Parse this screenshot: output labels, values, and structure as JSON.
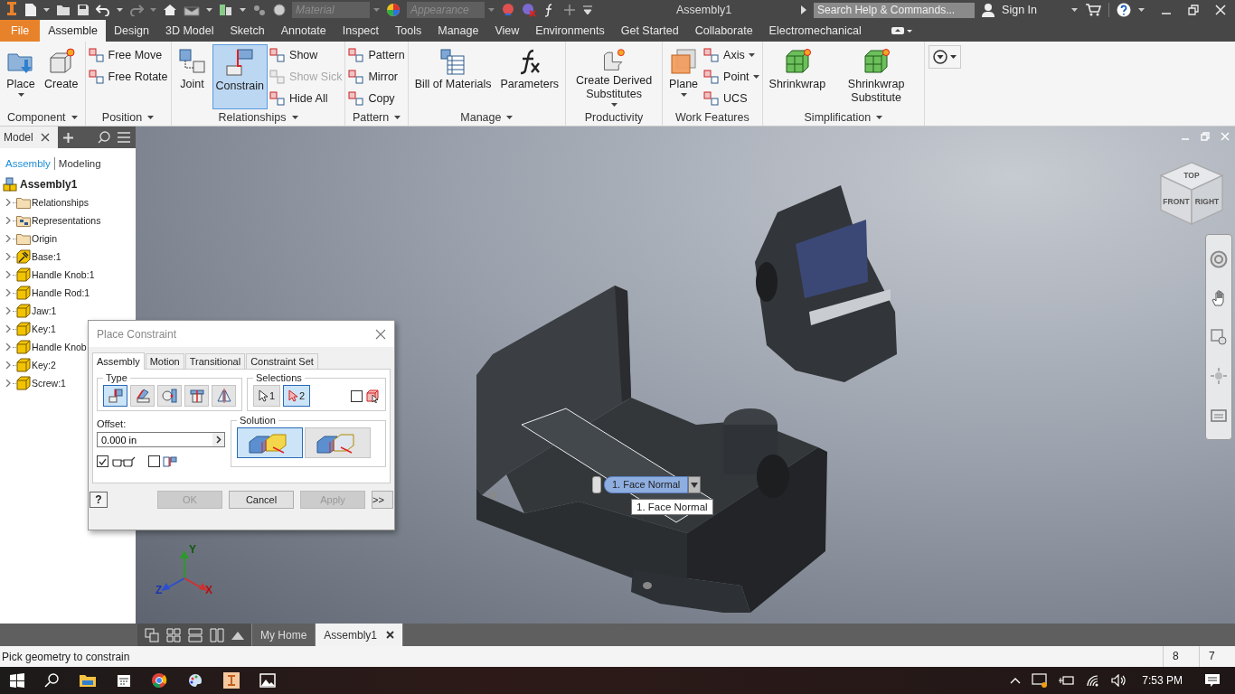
{
  "title_bar": {
    "title": "Assembly1",
    "material_field": {
      "placeholder": "Material"
    },
    "appearance_field": {
      "placeholder": "Appearance"
    },
    "search": {
      "placeholder": "Search Help & Commands..."
    },
    "sign_in": "Sign In"
  },
  "ribbon_tabs": [
    {
      "label": "File",
      "kind": "file",
      "selected": false
    },
    {
      "label": "Assemble",
      "kind": "tab",
      "selected": true
    },
    {
      "label": "Design",
      "kind": "tab",
      "selected": false
    },
    {
      "label": "3D Model",
      "kind": "tab",
      "selected": false
    },
    {
      "label": "Sketch",
      "kind": "tab",
      "selected": false
    },
    {
      "label": "Annotate",
      "kind": "tab",
      "selected": false
    },
    {
      "label": "Inspect",
      "kind": "tab",
      "selected": false
    },
    {
      "label": "Tools",
      "kind": "tab",
      "selected": false
    },
    {
      "label": "Manage",
      "kind": "tab",
      "selected": false
    },
    {
      "label": "View",
      "kind": "tab",
      "selected": false
    },
    {
      "label": "Environments",
      "kind": "tab",
      "selected": false
    },
    {
      "label": "Get Started",
      "kind": "tab",
      "selected": false
    },
    {
      "label": "Collaborate",
      "kind": "tab",
      "selected": false
    },
    {
      "label": "Electromechanical",
      "kind": "tab",
      "selected": false
    }
  ],
  "ribbon_panels": [
    {
      "title": "Component",
      "menu": true,
      "large": [
        {
          "label": "Place",
          "active": false,
          "menu": true
        },
        {
          "label": "Create",
          "active": false,
          "menu": false
        }
      ]
    },
    {
      "title": "Position",
      "menu": true,
      "small": [
        {
          "label": "Free Move",
          "disabled": false,
          "menu": false
        },
        {
          "label": "Free Rotate",
          "disabled": false,
          "menu": false
        }
      ]
    },
    {
      "title": "Relationships",
      "menu": true,
      "large": [
        {
          "label": "Joint",
          "active": false,
          "menu": false
        },
        {
          "label": "Constrain",
          "active": true,
          "menu": false
        }
      ],
      "small": [
        {
          "label": "Show",
          "disabled": false,
          "menu": false
        },
        {
          "label": "Show Sick",
          "disabled": true,
          "menu": false
        },
        {
          "label": "Hide All",
          "disabled": false,
          "menu": false
        }
      ]
    },
    {
      "title": "Pattern",
      "menu": true,
      "small": [
        {
          "label": "Pattern",
          "disabled": false,
          "menu": false
        },
        {
          "label": "Mirror",
          "disabled": false,
          "menu": false
        },
        {
          "label": "Copy",
          "disabled": false,
          "menu": false
        }
      ]
    },
    {
      "title": "Manage",
      "menu": true,
      "large": [
        {
          "label": "Bill of Materials",
          "active": false,
          "menu": false
        },
        {
          "label": "Parameters",
          "active": false,
          "menu": false
        }
      ]
    },
    {
      "title": "Productivity",
      "menu": false,
      "large": [
        {
          "label": "Create Derived Substitutes",
          "active": false,
          "menu": true
        }
      ]
    },
    {
      "title": "Work Features",
      "menu": false,
      "large": [
        {
          "label": "Plane",
          "active": false,
          "menu": true
        }
      ],
      "small": [
        {
          "label": "Axis",
          "disabled": false,
          "menu": true
        },
        {
          "label": "Point",
          "disabled": false,
          "menu": true
        },
        {
          "label": "UCS",
          "disabled": false,
          "menu": false
        }
      ]
    },
    {
      "title": "Simplification",
      "menu": true,
      "large": [
        {
          "label": "Shrinkwrap",
          "active": false,
          "menu": false
        },
        {
          "label": "Shrinkwrap Substitute",
          "active": false,
          "menu": false
        }
      ]
    }
  ],
  "browser": {
    "tab": "Model",
    "modes": [
      {
        "label": "Assembly",
        "selected": true
      },
      {
        "label": "Modeling",
        "selected": false
      }
    ],
    "tree": {
      "label": "Assembly1",
      "children": [
        {
          "label": "Relationships",
          "kind": "folder",
          "expanded": false
        },
        {
          "label": "Representations",
          "kind": "representations",
          "expanded": false
        },
        {
          "label": "Origin",
          "kind": "folder",
          "expanded": false
        },
        {
          "label": "Base:1",
          "kind": "grounded",
          "expanded": false
        },
        {
          "label": "Handle Knob:1",
          "kind": "part",
          "expanded": false
        },
        {
          "label": "Handle Rod:1",
          "kind": "part",
          "expanded": false
        },
        {
          "label": "Jaw:1",
          "kind": "part",
          "expanded": false
        },
        {
          "label": "Key:1",
          "kind": "part",
          "expanded": false
        },
        {
          "label": "Handle Knob",
          "kind": "part",
          "expanded": false
        },
        {
          "label": "Key:2",
          "kind": "part",
          "expanded": false
        },
        {
          "label": "Screw:1",
          "kind": "part",
          "expanded": false
        }
      ]
    }
  },
  "viewport": {
    "viewcube_faces": [
      "TOP",
      "FRONT",
      "RIGHT"
    ],
    "selection_dropdown": {
      "value": "1. Face Normal"
    },
    "tooltip": "1. Face Normal",
    "axes": [
      "Y",
      "Z",
      "X"
    ]
  },
  "dialog": {
    "title": "Place Constraint",
    "tabs": [
      {
        "label": "Assembly",
        "selected": true
      },
      {
        "label": "Motion",
        "selected": false
      },
      {
        "label": "Transitional",
        "selected": false
      },
      {
        "label": "Constraint Set",
        "selected": false
      }
    ],
    "type_group": {
      "title": "Type",
      "options": [
        {
          "selected": true
        },
        {
          "selected": false
        },
        {
          "selected": false
        },
        {
          "selected": false
        },
        {
          "selected": false
        }
      ]
    },
    "selections_group": {
      "title": "Selections",
      "picks": [
        {
          "label": "1",
          "selected": false
        },
        {
          "label": "2",
          "selected": true
        }
      ],
      "checkbox": {
        "checked": false
      }
    },
    "offset": {
      "label": "Offset:",
      "value": "0.000 in"
    },
    "options": [
      {
        "checked": true
      },
      {
        "checked": false
      }
    ],
    "solution_group": {
      "title": "Solution",
      "options": [
        {
          "selected": true
        },
        {
          "selected": false
        }
      ]
    },
    "help": "?",
    "buttons": [
      {
        "label": "OK",
        "disabled": true
      },
      {
        "label": "Cancel",
        "disabled": false
      },
      {
        "label": "Apply",
        "disabled": true
      },
      {
        "label": ">>",
        "disabled": false
      }
    ]
  },
  "doc_tabs": [
    {
      "label": "My Home",
      "selected": false,
      "closable": false
    },
    {
      "label": "Assembly1",
      "selected": true,
      "closable": true
    }
  ],
  "status_bar": {
    "prompt": "Pick geometry to constrain",
    "counts": [
      "8",
      "7"
    ]
  },
  "taskbar": {
    "time": "7:53 PM"
  }
}
